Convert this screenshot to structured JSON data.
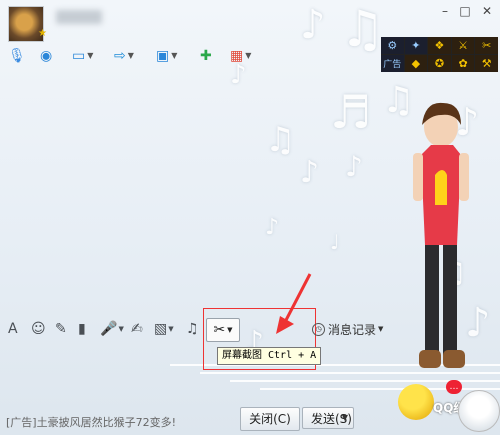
{
  "window": {
    "buttons": {
      "minimize": "–",
      "maximize": "□",
      "close": "✕"
    }
  },
  "header": {
    "star_badge": "★"
  },
  "toolbar": {
    "tools": [
      {
        "name": "voice-call-icon",
        "glyph": "🎙"
      },
      {
        "name": "video-call-icon",
        "glyph": "◉"
      },
      {
        "name": "remote-desktop-icon",
        "glyph": "▭"
      },
      {
        "name": "send-file-icon",
        "glyph": "⇨"
      },
      {
        "name": "screen-share-icon",
        "glyph": "▣"
      },
      {
        "name": "create-group-icon",
        "glyph": "✚"
      },
      {
        "name": "apps-icon",
        "glyph": "▦"
      }
    ]
  },
  "plugins": {
    "cells": [
      "⚙",
      "✦",
      "❖",
      "⚔",
      "✂",
      "广告",
      "◆",
      "✪",
      "✿",
      "⚒"
    ]
  },
  "editor_toolbar": {
    "font": "A",
    "emoji": "☺",
    "shake": "✎",
    "video": "▮",
    "voice": "🎤",
    "doodle": "✍",
    "image": "▧",
    "music": "♫",
    "screenshot": "✂"
  },
  "tooltip": {
    "text": "屏幕截图 Ctrl + A"
  },
  "history": {
    "label": "消息记录"
  },
  "footer": {
    "ad_text": "[广告]土豪披风居然比猴子72变多!",
    "close_button": "关闭(C)",
    "send_button": "发送(S)",
    "logo_text": "QQ经验"
  },
  "colors": {
    "highlight_border": "#ee3333",
    "tooltip_bg": "#ffffe1"
  }
}
